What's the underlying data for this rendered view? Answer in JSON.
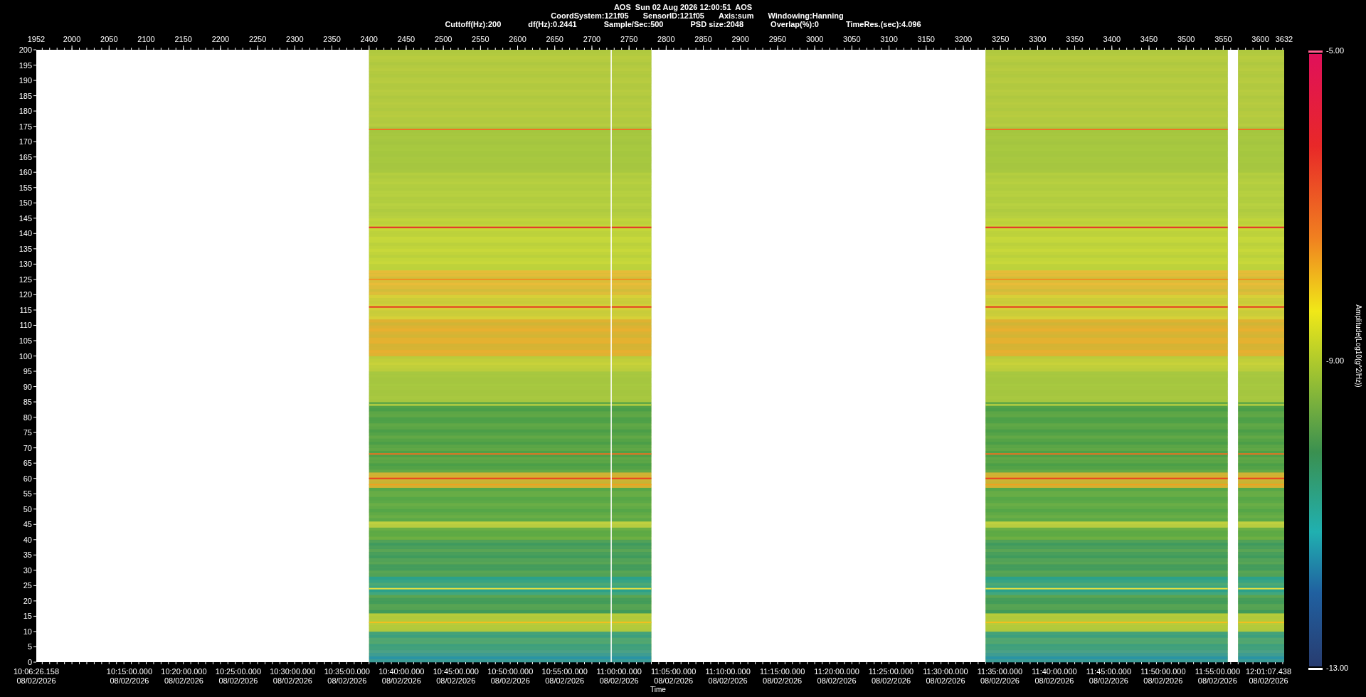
{
  "header": {
    "title": "AOS  Sun 02 Aug 2026 12:00:51  AOS",
    "line_2": [
      "CoordSystem:121f05",
      "SensorID:121f05",
      "Axis:sum",
      "Windowing:Hanning"
    ],
    "line_3": [
      "Cuttoff(Hz):200",
      "df(Hz):0.2441",
      "Sample/Sec:500",
      "PSD size:2048",
      "Overlap(%):0",
      "TimeRes.(sec):4.096"
    ]
  },
  "top_axis": {
    "ticks": [
      "1952",
      "2000",
      "2050",
      "2100",
      "2150",
      "2200",
      "2250",
      "2300",
      "2350",
      "2400",
      "2450",
      "2500",
      "2550",
      "2600",
      "2650",
      "2700",
      "2750",
      "2800",
      "2850",
      "2900",
      "2950",
      "3000",
      "3050",
      "3100",
      "3150",
      "3200",
      "3250",
      "3300",
      "3350",
      "3400",
      "3450",
      "3500",
      "3550",
      "3600",
      "3632"
    ]
  },
  "y_axis": {
    "ticks": [
      "200",
      "195",
      "190",
      "185",
      "180",
      "175",
      "170",
      "165",
      "160",
      "155",
      "150",
      "145",
      "140",
      "135",
      "130",
      "125",
      "120",
      "115",
      "110",
      "105",
      "100",
      "95",
      "90",
      "85",
      "80",
      "75",
      "70",
      "65",
      "60",
      "55",
      "50",
      "45",
      "40",
      "35",
      "30",
      "25",
      "20",
      "15",
      "10",
      "5",
      "0"
    ]
  },
  "time_axis": {
    "label": "Time",
    "ticks": [
      {
        "time": "10:06:26.158",
        "date": "08/02/2026"
      },
      {
        "time": "10:15:00.000",
        "date": "08/02/2026"
      },
      {
        "time": "10:20:00.000",
        "date": "08/02/2026"
      },
      {
        "time": "10:25:00.000",
        "date": "08/02/2026"
      },
      {
        "time": "10:30:00.000",
        "date": "08/02/2026"
      },
      {
        "time": "10:35:00.000",
        "date": "08/02/2026"
      },
      {
        "time": "10:40:00.000",
        "date": "08/02/2026"
      },
      {
        "time": "10:45:00.000",
        "date": "08/02/2026"
      },
      {
        "time": "10:50:00.000",
        "date": "08/02/2026"
      },
      {
        "time": "10:55:00.000",
        "date": "08/02/2026"
      },
      {
        "time": "11:00:00.000",
        "date": "08/02/2026"
      },
      {
        "time": "11:05:00.000",
        "date": "08/02/2026"
      },
      {
        "time": "11:10:00.000",
        "date": "08/02/2026"
      },
      {
        "time": "11:15:00.000",
        "date": "08/02/2026"
      },
      {
        "time": "11:20:00.000",
        "date": "08/02/2026"
      },
      {
        "time": "11:25:00.000",
        "date": "08/02/2026"
      },
      {
        "time": "11:30:00.000",
        "date": "08/02/2026"
      },
      {
        "time": "11:35:00.000",
        "date": "08/02/2026"
      },
      {
        "time": "11:40:00.000",
        "date": "08/02/2026"
      },
      {
        "time": "11:45:00.000",
        "date": "08/02/2026"
      },
      {
        "time": "11:50:00.000",
        "date": "08/02/2026"
      },
      {
        "time": "11:55:00.000",
        "date": "08/02/2026"
      },
      {
        "time": "12:01:07.438",
        "date": "08/02/2026"
      }
    ]
  },
  "colorbar": {
    "title": "Amplitude(Log10(g^2/Hz))",
    "max": "-5.00",
    "mid": "-9.00",
    "min": "-13.00"
  }
}
